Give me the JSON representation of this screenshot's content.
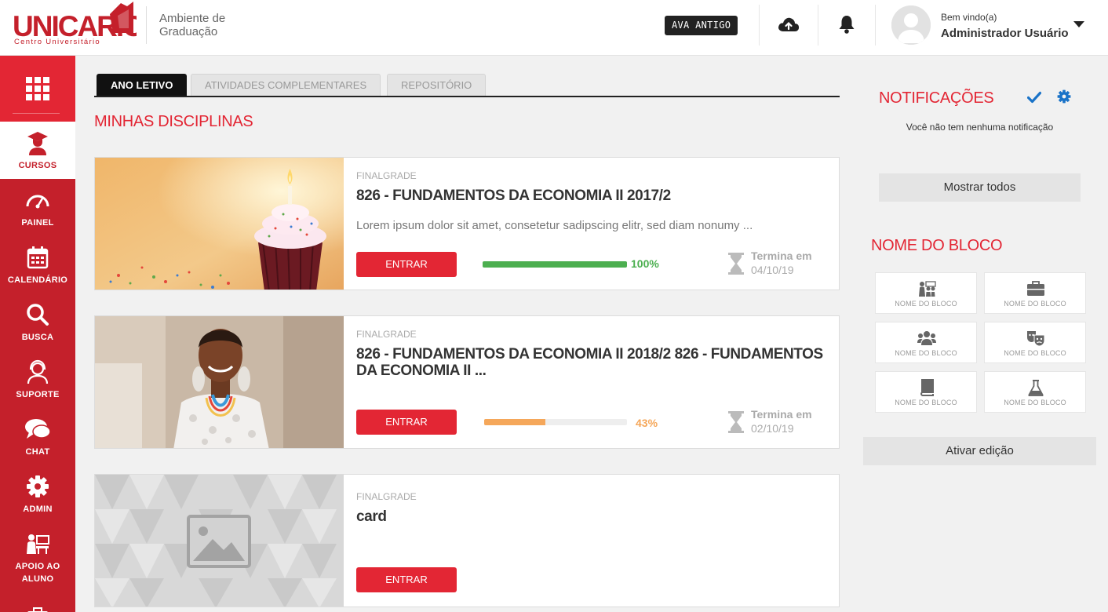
{
  "header": {
    "logo_text": "UNICARIOCA",
    "logo_subtitle": "Centro Universitário",
    "environment": "Ambiente de Graduação",
    "ava_button": "AVA ANTIGO",
    "icons": [
      "cloud-upload-icon",
      "bell-icon"
    ],
    "welcome": "Bem vindo(a)",
    "username": "Administrador Usuário"
  },
  "sidebar": {
    "items": [
      {
        "label": "CURSOS",
        "icon": "graduate-icon",
        "active": true
      },
      {
        "label": "PAINEL",
        "icon": "dashboard-gauge-icon"
      },
      {
        "label": "CALENDÁRIO",
        "icon": "calendar-icon"
      },
      {
        "label": "BUSCA",
        "icon": "search-icon"
      },
      {
        "label": "SUPORTE",
        "icon": "support-agent-icon"
      },
      {
        "label": "CHAT",
        "icon": "chat-icon"
      },
      {
        "label": "ADMIN",
        "icon": "gear-icon"
      },
      {
        "label": "APOIO AO ALUNO",
        "icon": "student-support-icon"
      }
    ]
  },
  "tabs": [
    "ANO LETIVO",
    "ATIVIDADES COMPLEMENTARES",
    "REPOSITÓRIO"
  ],
  "active_tab": "ANO LETIVO",
  "section_title": "MINHAS DISCIPLINAS",
  "courses": [
    {
      "category": "FINALGRADE",
      "title": "826 - FUNDAMENTOS DA ECONOMIA II 2017/2",
      "description": "Lorem ipsum dolor sit amet, consetetur sadipscing elitr, sed diam nonumy ...",
      "button": "ENTRAR",
      "progress": 100,
      "progress_label": "100%",
      "progress_color": "#4caf50",
      "ends_label": "Termina em",
      "ends_date": "04/10/19"
    },
    {
      "category": "FINALGRADE",
      "title": "826 - FUNDAMENTOS DA ECONOMIA II 2018/2 826 - FUNDAMENTOS DA ECONOMIA II ...",
      "description": "",
      "button": "ENTRAR",
      "progress": 43,
      "progress_label": "43%",
      "progress_color": "#f5a75a",
      "ends_label": "Termina em",
      "ends_date": "02/10/19"
    },
    {
      "category": "FINALGRADE",
      "title": "card",
      "description": "",
      "button": "ENTRAR"
    }
  ],
  "notifications": {
    "title": "NOTIFICAÇÕES",
    "empty_text": "Você não tem nenhuma notificação",
    "show_all": "Mostrar todos"
  },
  "block": {
    "title": "NOME DO BLOCO",
    "items": [
      {
        "label": "NOME DO BLOCO",
        "icon": "class-teacher-icon"
      },
      {
        "label": "NOME DO BLOCO",
        "icon": "briefcase-icon"
      },
      {
        "label": "NOME DO BLOCO",
        "icon": "users-group-icon"
      },
      {
        "label": "NOME DO BLOCO",
        "icon": "theater-masks-icon"
      },
      {
        "label": "NOME DO BLOCO",
        "icon": "book-icon"
      },
      {
        "label": "NOME DO BLOCO",
        "icon": "flask-icon"
      }
    ],
    "edit_button": "Ativar edição"
  },
  "colors": {
    "brand_red": "#e32634",
    "sidebar_red": "#c4202b"
  }
}
